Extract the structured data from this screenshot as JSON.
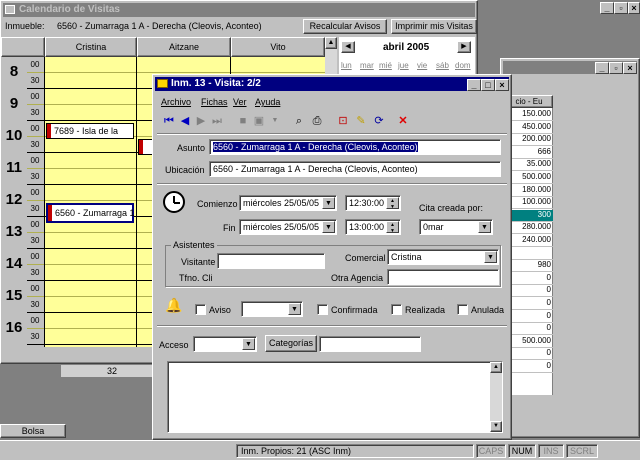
{
  "cal_window": {
    "title": "Calendario de Visitas",
    "inmueble_label": "Inmueble:",
    "inmueble_value": "6560 - Zumarraga 1 A - Derecha (Cleovis, Aconteo)",
    "recalc_button": "Recalcular Avisos",
    "print_button": "Imprimir mis Visitas",
    "columns": [
      "Cristina",
      "Aitzane",
      "Vito"
    ],
    "hours": [
      "8",
      "9",
      "10",
      "11",
      "12",
      "13",
      "14",
      "15",
      "16"
    ],
    "minutes": [
      "00",
      "30"
    ],
    "events": [
      {
        "label": "7689 - Isla de la"
      },
      {
        "label": "6560 - Zumarraga 1"
      }
    ],
    "month_title": "abril 2005",
    "weekdays": [
      "lun",
      "mar",
      "mié",
      "jue",
      "vie",
      "sáb",
      "dom"
    ],
    "bottom_number": "32",
    "bolsa_tab": "Bolsa"
  },
  "back_table": {
    "header": "cio - Eu",
    "values": [
      "150.000",
      "450.000",
      "200.000",
      "666",
      "35.000",
      "500.000",
      "180.000",
      "100.000",
      "300",
      "280.000",
      "240.000",
      "",
      "980",
      "0",
      "0",
      "0",
      "0",
      "0",
      "500.000",
      "0",
      "0"
    ],
    "selected_index": 8
  },
  "dialog": {
    "title": "Inm. 13 - Visita: 2/2",
    "menu": [
      "Archivo",
      "Fichas",
      "Ver",
      "Ayuda"
    ],
    "asunto_label": "Asunto",
    "asunto_value": "6560 - Zumarraga 1 A - Derecha (Cleovis, Aconteo)",
    "ubicacion_label": "Ubicación",
    "ubicacion_value": "6560 - Zumarraga 1 A - Derecha (Cleovis, Aconteo)",
    "comienzo_label": "Comienzo",
    "comienzo_date": "miércoles 25/05/05",
    "comienzo_time": "12:30:00",
    "fin_label": "Fin",
    "fin_date": "miércoles 25/05/05",
    "fin_time": "13:00:00",
    "cita_label": "Cita creada por:",
    "cita_value": "0mar",
    "asistentes_label": "Asistentes",
    "visitante_label": "Visitante",
    "visitante_value": "",
    "comercial_label": "Comercial",
    "comercial_value": "Cristina",
    "tfno_label": "Tfno. Cli",
    "otra_agencia_label": "Otra Agencia",
    "otra_agencia_value": "",
    "aviso_label": "Aviso",
    "confirmada_label": "Confirmada",
    "realizada_label": "Realizada",
    "anulada_label": "Anulada",
    "acceso_label": "Acceso",
    "categorias_button": "Categorías",
    "categorias_value": "",
    "notes_value": ""
  },
  "statusbar": {
    "text": "Inm. Propios: 21   (ASC Inm)",
    "caps": "CAPS",
    "num": "NUM",
    "ins": "INS",
    "scrl": "SCRL"
  }
}
